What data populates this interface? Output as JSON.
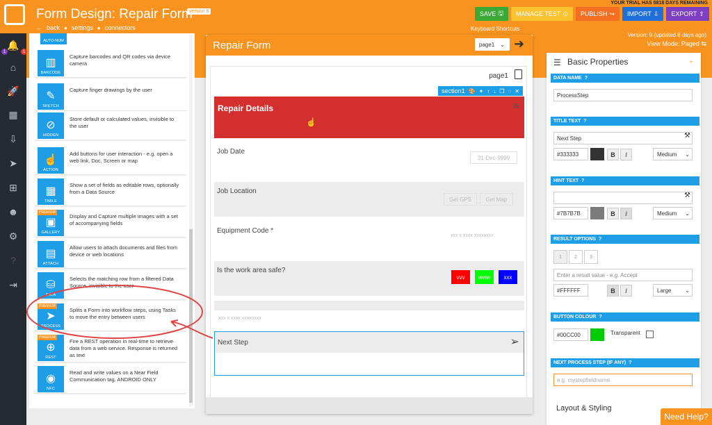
{
  "header": {
    "app_title": "Form Design: Repair Form",
    "version_badge": "version 9",
    "subnav": {
      "back": "back",
      "settings": "settings",
      "connectors": "connectors"
    },
    "trial_notice": "YOUR TRIAL HAS 5818 DAYS REMAINING",
    "buttons": {
      "save": "SAVE",
      "manage_test": "MANAGE TEST",
      "publish": "PUBLISH",
      "import": "IMPORT",
      "export": "EXPORT"
    },
    "keyboard_shortcuts": "Keyboard Shortcuts",
    "version_info": "Version: 9 (updated 8 days ago)",
    "view_mode": "View Mode: Paged",
    "colors": {
      "brand": "#f7931e",
      "save": "#3aa935",
      "manage_test": "#f9c22e",
      "publish": "#f26f21",
      "import": "#1e6fd9",
      "export": "#7e3fc2"
    }
  },
  "sidebar": {
    "badges": [
      "1",
      "1"
    ],
    "icons": [
      "bell-icon",
      "home-icon",
      "rocket-icon",
      "table-icon",
      "download-icon",
      "send-icon",
      "sitemap-icon",
      "users-icon",
      "cogs-icon",
      "help-icon",
      "signout-icon"
    ]
  },
  "palette": {
    "partial_top_label": "AUTO-NUM",
    "items": [
      {
        "label": "BARCODE",
        "desc": "Capture barcodes and QR codes via device camera",
        "glyph": "▥",
        "premium": false
      },
      {
        "label": "SKETCH",
        "desc": "Capture finger drawings by the user",
        "glyph": "✎",
        "premium": false
      },
      {
        "label": "HIDDEN",
        "desc": "Store default or calculated values, invisible to the user",
        "glyph": "⊘",
        "premium": false
      },
      {
        "label": "ACTION",
        "desc": "Add buttons for user interaction - e.g. open a web link, Doc, Screen or map",
        "glyph": "☝",
        "premium": false
      },
      {
        "label": "TABLE",
        "desc": "Show a set of fields as editable rows, optionally from a Data Source",
        "glyph": "▦",
        "premium": false
      },
      {
        "label": "GALLERY",
        "desc": "Display and Capture multiple images with a set of accompanying fields",
        "glyph": "▣",
        "premium": true
      },
      {
        "label": "ATTACH",
        "desc": "Allow users to attach documents and files from device or web locations",
        "glyph": "▤",
        "premium": false
      },
      {
        "label": "DATA",
        "desc": "Selects the matching row from a filtered Data Source, invisible to the user",
        "glyph": "⛁",
        "premium": false
      },
      {
        "label": "PROCESS",
        "desc": "Splits a Form into workflow steps, using Tasks to move the entry between users",
        "glyph": "➤",
        "premium": true
      },
      {
        "label": "REST",
        "desc": "Fire a REST operation in real-time to retrieve data from a web service. Response is returned as text",
        "glyph": "⊕",
        "premium": true
      },
      {
        "label": "NFC",
        "desc": "Read and write values on a Near Field Communication tag. ANDROID ONLY",
        "glyph": "◉",
        "premium": false
      }
    ],
    "premium_label": "PREMIUM"
  },
  "form": {
    "title": "Repair Form",
    "page_select": "page1",
    "page_label": "page1",
    "section_name": "section1",
    "section_heading": "Repair Details",
    "fields": {
      "job_date": {
        "label": "Job Date",
        "placeholder": "31-Dec-9999"
      },
      "job_location": {
        "label": "Job Location",
        "btn_gps": "Get GPS",
        "btn_map": "Get Map"
      },
      "equipment_code": {
        "label": "Equipment Code *",
        "placeholder": "xxx x xxxx xxxxxxxx"
      },
      "work_area_safe": {
        "label": "Is the work area safe?",
        "options": [
          {
            "label": "vvv",
            "color": "#ff0000"
          },
          {
            "label": "www",
            "color": "#00ff00"
          },
          {
            "label": "xxx",
            "color": "#0000ff"
          }
        ]
      },
      "blank_field": {
        "placeholder": "xxx x xxxx xxxxxxxx"
      },
      "next_step": {
        "label": "Next Step"
      }
    },
    "colors": {
      "section_red": "#d32f2f"
    }
  },
  "properties": {
    "title": "Basic Properties",
    "data_name": {
      "heading": "DATA NAME",
      "value": "ProcessStep"
    },
    "title_text": {
      "heading": "TITLE TEXT",
      "value": "Next Step",
      "color": "#333333",
      "size": "Medium"
    },
    "hint_text": {
      "heading": "HINT TEXT",
      "value": "",
      "color": "#7B7B7B",
      "size": "Medium"
    },
    "result_options": {
      "heading": "RESULT OPTIONS",
      "tabs": [
        "1",
        "2",
        "3"
      ],
      "placeholder": "Enter a result value - e.g. Accept",
      "color": "#FFFFFF",
      "size": "Large"
    },
    "button_colour": {
      "heading": "BUTTON COLOUR",
      "value": "#00CC00",
      "transparent_label": "Transparent"
    },
    "next_process_step": {
      "heading": "NEXT PROCESS STEP (IF ANY)",
      "placeholder": "e.g. mystepfieldname"
    },
    "partial_footer": "Layout & Styling"
  },
  "help_button": "Need Help?"
}
